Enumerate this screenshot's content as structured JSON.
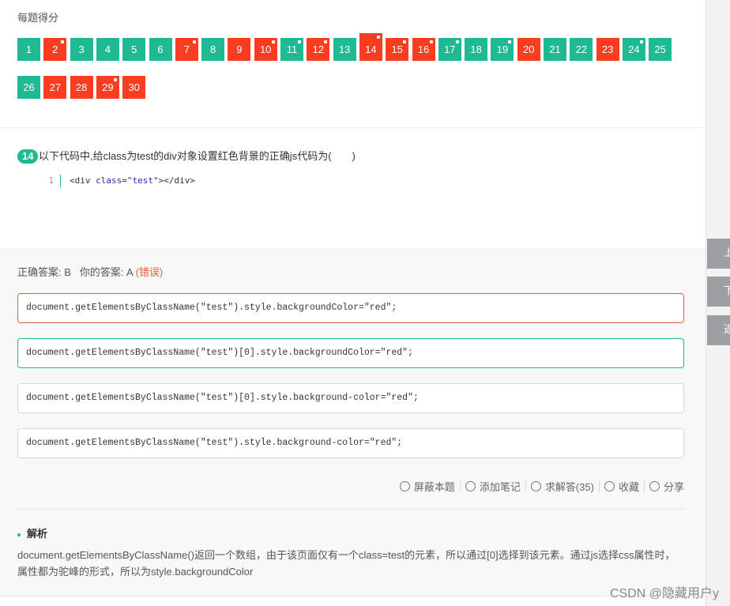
{
  "score": {
    "title": "每题得分",
    "questions": [
      {
        "n": "1",
        "status": "ok",
        "mark": false
      },
      {
        "n": "2",
        "status": "bad",
        "mark": true
      },
      {
        "n": "3",
        "status": "ok",
        "mark": false
      },
      {
        "n": "4",
        "status": "ok",
        "mark": false
      },
      {
        "n": "5",
        "status": "ok",
        "mark": false
      },
      {
        "n": "6",
        "status": "ok",
        "mark": false
      },
      {
        "n": "7",
        "status": "bad",
        "mark": true
      },
      {
        "n": "8",
        "status": "ok",
        "mark": false
      },
      {
        "n": "9",
        "status": "bad",
        "mark": false
      },
      {
        "n": "10",
        "status": "bad",
        "mark": true
      },
      {
        "n": "11",
        "status": "ok",
        "mark": true
      },
      {
        "n": "12",
        "status": "bad",
        "mark": true
      },
      {
        "n": "13",
        "status": "ok",
        "mark": false
      },
      {
        "n": "14",
        "status": "bad",
        "mark": true,
        "current": true
      },
      {
        "n": "15",
        "status": "bad",
        "mark": true
      },
      {
        "n": "16",
        "status": "bad",
        "mark": true
      },
      {
        "n": "17",
        "status": "ok",
        "mark": true
      },
      {
        "n": "18",
        "status": "ok",
        "mark": false
      },
      {
        "n": "19",
        "status": "ok",
        "mark": true
      },
      {
        "n": "20",
        "status": "bad",
        "mark": false
      },
      {
        "n": "21",
        "status": "ok",
        "mark": false
      },
      {
        "n": "22",
        "status": "ok",
        "mark": false
      },
      {
        "n": "23",
        "status": "bad",
        "mark": false
      },
      {
        "n": "24",
        "status": "ok",
        "mark": true
      },
      {
        "n": "25",
        "status": "ok",
        "mark": false
      },
      {
        "n": "26",
        "status": "ok",
        "mark": false
      },
      {
        "n": "27",
        "status": "bad",
        "mark": false
      },
      {
        "n": "28",
        "status": "bad",
        "mark": false
      },
      {
        "n": "29",
        "status": "bad",
        "mark": true
      },
      {
        "n": "30",
        "status": "bad",
        "mark": false
      }
    ]
  },
  "question": {
    "number": "14",
    "text": "以下代码中,给class为test的div对象设置红色背景的正确js代码为(　　)",
    "code": {
      "line_no": "1",
      "open": "<div ",
      "attr": "class",
      "eq": "=",
      "value": "\"test\"",
      "close": "></div>"
    }
  },
  "answers": {
    "correct_label": "正确答案: B",
    "yours_label": "你的答案: A",
    "verdict": "(错误)"
  },
  "options": [
    {
      "text": "document.getElementsByClassName(\"test\").style.backgroundColor=\"red\";",
      "state": "wrong-choice"
    },
    {
      "text": "document.getElementsByClassName(\"test\")[0].style.backgroundColor=\"red\";",
      "state": "correct-choice"
    },
    {
      "text": "document.getElementsByClassName(\"test\")[0].style.background-color=\"red\";",
      "state": ""
    },
    {
      "text": "document.getElementsByClassName(\"test\").style.background-color=\"red\";",
      "state": ""
    }
  ],
  "actions": {
    "block": "屏蔽本题",
    "note": "添加笔记",
    "ask": "求解答(35)",
    "fav": "收藏",
    "share": "分享"
  },
  "analysis": {
    "title": "解析",
    "text": "document.getElementsByClassName()返回一个数组，由于该页面仅有一个class=test的元素，所以通过[0]选择到该元素。通过js选择css属性时，属性都为驼峰的形式，所以为style.backgroundColor"
  },
  "rail": {
    "prev": "上一题",
    "next": "下一题",
    "back": "返回"
  },
  "watermark": "CSDN @隐藏用户y",
  "colors": {
    "correct": "#1fb994",
    "wrong": "#fa3c21",
    "rail": "#9d9fa3"
  }
}
